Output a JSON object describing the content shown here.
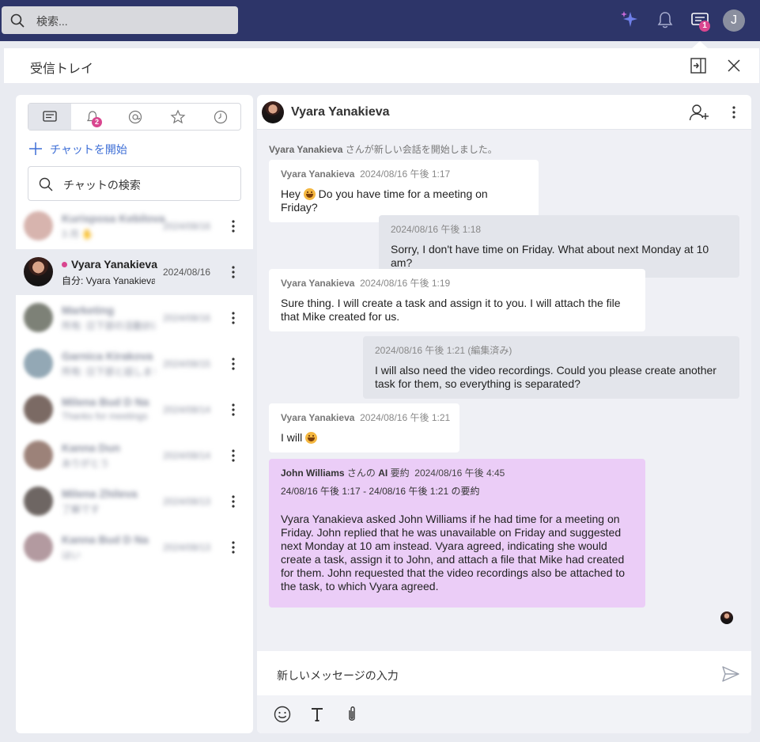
{
  "topbar": {
    "search_placeholder": "検索...",
    "chat_badge": "1",
    "avatar_letter": "J"
  },
  "panel": {
    "title": "受信トレイ"
  },
  "left": {
    "tab_badge": "2",
    "start_chat": "チャットを開始",
    "search_placeholder": "チャットの検索",
    "conversations": [
      {
        "name": "Kurisposa Kebilova",
        "preview": "3 月 ✋",
        "date": "2024/08/16"
      },
      {
        "name": "Vyara Yanakieva",
        "preview": "自分: Vyara Yanakieva asked",
        "date": "2024/08/16"
      },
      {
        "name": "Marketing",
        "preview": "所有: 日下部の活動計画",
        "date": "2024/08/16"
      },
      {
        "name": "Garnica Kirakova",
        "preview": "所有: 日下部と話しました",
        "date": "2024/08/15"
      },
      {
        "name": "Milena Bud D Na",
        "preview": "Thanks for meetings",
        "date": "2024/08/14"
      },
      {
        "name": "Kanna Dun",
        "preview": "ありがとう",
        "date": "2024/08/14"
      },
      {
        "name": "Milena Zhileva",
        "preview": "了解です",
        "date": "2024/08/13"
      },
      {
        "name": "Kanna Bud D Na",
        "preview": "はい",
        "date": "2024/08/13"
      }
    ]
  },
  "conversation": {
    "name": "Vyara Yanakieva",
    "system_name": "Vyara Yanakieva",
    "system_text": " さんが新しい会話を開始しました。",
    "messages": [
      {
        "sender": "Vyara Yanakieva",
        "time": "2024/08/16 午後 1:17",
        "text_a": "Hey ",
        "text_b": " Do you have time for a meeting on Friday?"
      },
      {
        "time": "2024/08/16 午後 1:18",
        "text": "Sorry, I don't have time on Friday. What about next Monday at 10 am?"
      },
      {
        "sender": "Vyara Yanakieva",
        "time": "2024/08/16 午後 1:19",
        "text": "Sure thing. I will create a task and assign it to you. I will attach the file that Mike created for us."
      },
      {
        "time": "2024/08/16 午後 1:21 (編集済み)",
        "text": "I will also need the video recordings. Could you please create another task for them, so everything is separated?"
      },
      {
        "sender": "Vyara Yanakieva",
        "time": "2024/08/16 午後 1:21",
        "text_a": "I will "
      }
    ],
    "ai_summary": {
      "author": "John Williams",
      "author_suffix": " さんの ",
      "ai_label": "AI",
      "label_suffix": " 要約",
      "time": "2024/08/16 午後 4:45",
      "range": "24/08/16 午後 1:17 - 24/08/16 午後 1:21 の要約",
      "text": "Vyara Yanakieva asked John Williams if he had time for a meeting on Friday. John replied that he was unavailable on Friday and suggested next Monday at 10 am instead. Vyara agreed, indicating she would create a task, assign it to John, and attach a file that Mike had created for them. John requested that the video recordings also be attached to the task, to which Vyara agreed."
    },
    "composer_placeholder": "新しいメッセージの入力"
  },
  "colors": {
    "topbar": "#2d3569",
    "accent": "#3d6ed6",
    "badge": "#d9468f",
    "ai_bubble": "#ebcdf7"
  }
}
